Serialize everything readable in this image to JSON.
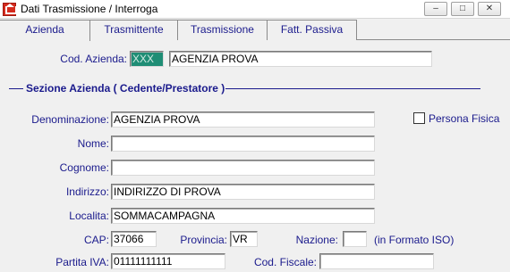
{
  "window": {
    "title": "Dati Trasmissione / Interroga",
    "minimize_glyph": "–",
    "restore_glyph": "□",
    "close_glyph": "✕"
  },
  "tabs": [
    {
      "label": "Azienda"
    },
    {
      "label": "Trasmittente"
    },
    {
      "label": "Trasmissione"
    },
    {
      "label": "Fatt. Passiva"
    }
  ],
  "header": {
    "cod_azienda_label": "Cod. Azienda:",
    "cod_azienda_value": "XXX",
    "azienda_name_value": "AGENZIA PROVA"
  },
  "section": {
    "title": "Sezione Azienda ( Cedente/Prestatore )"
  },
  "form": {
    "denominazione_label": "Denominazione:",
    "denominazione_value": "AGENZIA PROVA",
    "persona_fisica_label": "Persona Fisica",
    "nome_label": "Nome:",
    "nome_value": "",
    "cognome_label": "Cognome:",
    "cognome_value": "",
    "indirizzo_label": "Indirizzo:",
    "indirizzo_value": "INDIRIZZO DI PROVA",
    "localita_label": "Localita:",
    "localita_value": "SOMMACAMPAGNA",
    "cap_label": "CAP:",
    "cap_value": "37066",
    "provincia_label": "Provincia:",
    "provincia_value": "VR",
    "nazione_label": "Nazione:",
    "nazione_value": "",
    "nazione_hint": "(in Formato ISO)",
    "partita_iva_label": "Partita IVA:",
    "partita_iva_value": "01111111111",
    "cod_fiscale_label": "Cod. Fiscale:",
    "cod_fiscale_value": ""
  },
  "colors": {
    "label_text": "#1a1a8c",
    "code_field_bg": "#1f8d75",
    "window_bg": "#f0f0f0"
  }
}
